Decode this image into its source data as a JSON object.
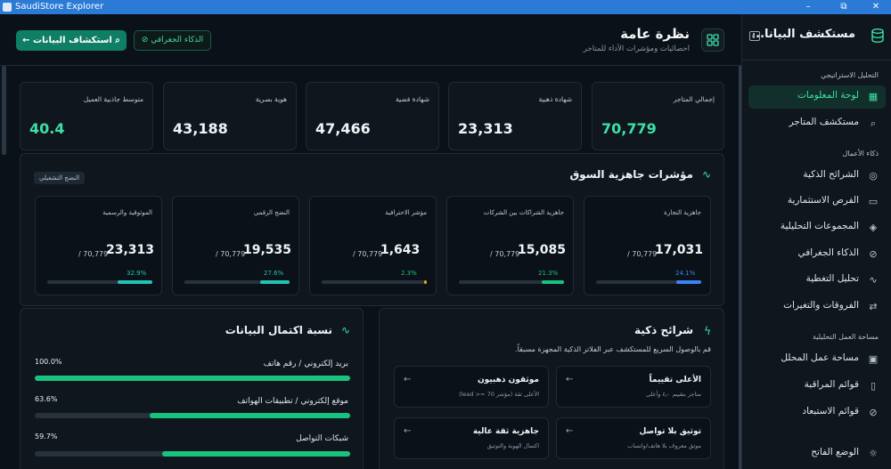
{
  "window": {
    "title": "SaudiStore Explorer",
    "minimize": "–",
    "maximize": "⧉",
    "close": "✕"
  },
  "sidebar": {
    "title": "مستكشف البيانا...",
    "sections": [
      {
        "label": "التحليل الاستراتيجي"
      },
      {
        "label": "ذكاء الأعمال"
      },
      {
        "label": "مساحة العمل التحليلية"
      }
    ],
    "items": [
      {
        "label": "لوحة المعلومات",
        "icon": "grid-icon"
      },
      {
        "label": "مستكشف المتاجر",
        "icon": "search-icon"
      },
      {
        "label": "الشرائح الذكية",
        "icon": "target-icon"
      },
      {
        "label": "الفرص الاستثمارية",
        "icon": "briefcase-icon"
      },
      {
        "label": "المجموعات التحليلية",
        "icon": "layers-icon"
      },
      {
        "label": "الذكاء الجغرافي",
        "icon": "compass-icon"
      },
      {
        "label": "تحليل التغطية",
        "icon": "pulse-icon"
      },
      {
        "label": "الفروقات والتغيرات",
        "icon": "swap-icon"
      },
      {
        "label": "مساحة عمل المحلل",
        "icon": "terminal-icon"
      },
      {
        "label": "قوائم المراقبة",
        "icon": "bookmark-icon"
      },
      {
        "label": "قوائم الاستبعاد",
        "icon": "ban-icon"
      },
      {
        "label": "الوضع الفاتح",
        "icon": "sun-icon"
      }
    ]
  },
  "header": {
    "title": "نظرة عامة",
    "subtitle": "احصائيات ومؤشرات الأداء للمتاجر",
    "explore_button": "استكشاف البيانات",
    "geo_button": "الذكاء الجغرافي"
  },
  "stats": [
    {
      "label": "إجمالي المتاجر",
      "value": "70,779",
      "accent": true
    },
    {
      "label": "شهادة ذهبية",
      "value": "23,313",
      "accent": false
    },
    {
      "label": "شهادة فضية",
      "value": "47,466",
      "accent": false
    },
    {
      "label": "هوية بصرية",
      "value": "43,188",
      "accent": false
    },
    {
      "label": "متوسط جاذبية العميل",
      "value": "40.4",
      "accent": true
    }
  ],
  "readiness": {
    "title": "مؤشرات جاهزية السوق",
    "badge": "النضج التشغيلي",
    "cards": [
      {
        "label": "جاهزية التجارة",
        "value": "17,031",
        "total": "/ 70,779",
        "pct": "24.1%",
        "fraction": 0.241,
        "color": "#3b82f6"
      },
      {
        "label": "جاهزية الشراكات بين الشركات",
        "value": "15,085",
        "total": "/ 70,779",
        "pct": "21.3%",
        "fraction": 0.213,
        "color": "#18c47d"
      },
      {
        "label": "مؤشر الاحترافية",
        "value": "1,643",
        "total": "/ 70,779",
        "pct": "2.3%",
        "fraction": 0.023,
        "color": "#f59e0b"
      },
      {
        "label": "النضج الرقمي",
        "value": "19,535",
        "total": "/ 70,779",
        "pct": "27.6%",
        "fraction": 0.276,
        "color": "#22c3b5"
      },
      {
        "label": "الموثوقية والرسمية",
        "value": "23,313",
        "total": "/ 70,779",
        "pct": "32.9%",
        "fraction": 0.329,
        "color": "#22c3b5"
      }
    ]
  },
  "completeness": {
    "title": "نسبة اكتمال البيانات",
    "rows": [
      {
        "label": "بريد إلكتروني / رقم هاتف",
        "pct": "100.0%",
        "fraction": 1.0
      },
      {
        "label": "موقع إلكتروني / تطبيقات الهواتف",
        "pct": "63.6%",
        "fraction": 0.636
      },
      {
        "label": "شبكات التواصل",
        "pct": "59.7%",
        "fraction": 0.597
      }
    ]
  },
  "segments": {
    "title": "شرائح ذكية",
    "desc": "قم بالوصول السريع للمستكشف عبر الفلاتر الذكية المجهزة مسبقاً.",
    "cards": [
      {
        "title": "الأعلى تقييماً",
        "sub": "متاجر بتقييم ٤٫٠ وأعلى"
      },
      {
        "title": "موثقون ذهبيون",
        "sub": "الأعلى ثقة (مؤشر 70 =< lead)"
      },
      {
        "title": "توثيق بلا تواصل",
        "sub": "موثق معروف بلا هاتف/واتساب"
      },
      {
        "title": "جاهزية ثقة عالية",
        "sub": "اكتمال الهوية والتوثيق"
      }
    ]
  },
  "colors": {
    "accent": "#3ee0a6",
    "primary_button": "#0e7e64",
    "progress": "#18c47d"
  }
}
